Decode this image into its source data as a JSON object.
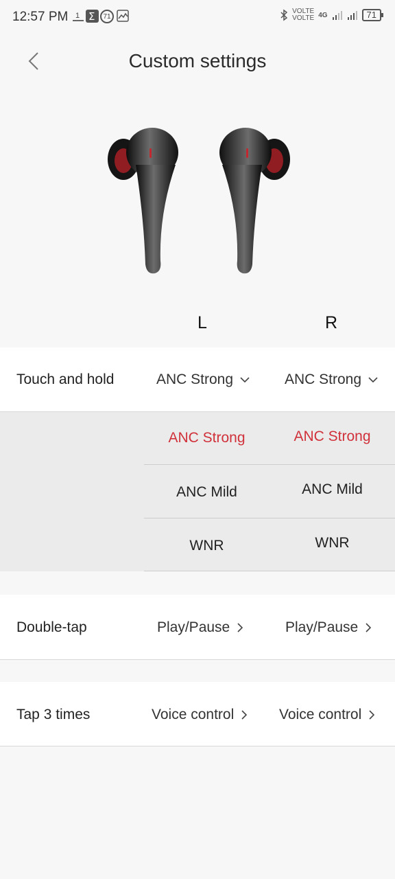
{
  "status": {
    "time": "12:57 PM",
    "volte1": "VOLTE",
    "volte2": "VOLTE",
    "network": "4G",
    "battery": "71",
    "notification_badge": "71"
  },
  "header": {
    "title": "Custom settings"
  },
  "labels": {
    "left": "L",
    "right": "R"
  },
  "touch_and_hold": {
    "label": "Touch and hold",
    "left_value": "ANC Strong",
    "right_value": "ANC Strong",
    "options_left": [
      "ANC Strong",
      "ANC Mild",
      "WNR"
    ],
    "options_right": [
      "ANC Strong",
      "ANC Mild",
      "WNR"
    ],
    "selected_color": "#d0313a"
  },
  "double_tap": {
    "label": "Double-tap",
    "left_value": "Play/Pause",
    "right_value": "Play/Pause"
  },
  "tap_3_times": {
    "label": "Tap 3 times",
    "left_value": "Voice control",
    "right_value": "Voice control"
  }
}
